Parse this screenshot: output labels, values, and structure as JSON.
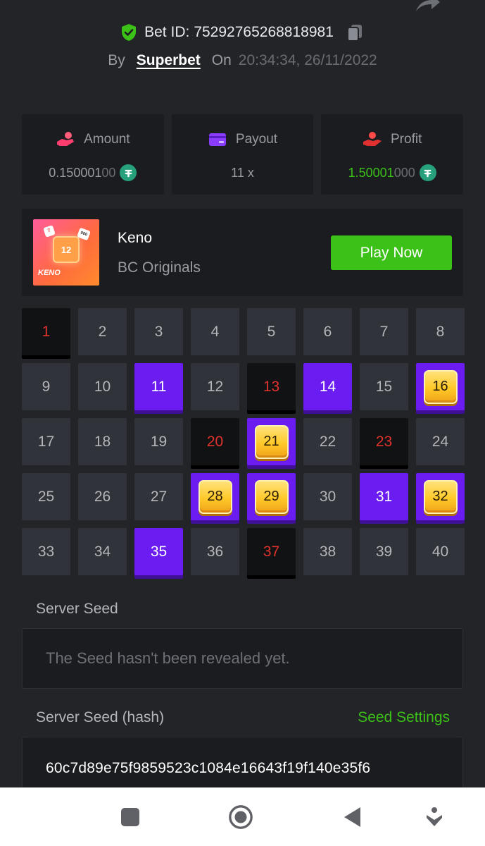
{
  "header": {
    "bet_id_label": "Bet ID:",
    "bet_id": "75292765268818981",
    "by_label": "By",
    "house": "Superbet",
    "on_label": "On",
    "timestamp": "20:34:34, 26/11/2022"
  },
  "stats": {
    "amount": {
      "label": "Amount",
      "value_main": "0.150001",
      "value_dim": "00"
    },
    "payout": {
      "label": "Payout",
      "value": "11 x"
    },
    "profit": {
      "label": "Profit",
      "value_main": "1.50001",
      "value_dim": "000"
    }
  },
  "game": {
    "name": "Keno",
    "provider": "BC Originals",
    "play_label": "Play Now",
    "thumb_number": "12",
    "thumb_label": "KENO"
  },
  "keno": {
    "cells": [
      {
        "n": "1",
        "s": "miss"
      },
      {
        "n": "2",
        "s": "none"
      },
      {
        "n": "3",
        "s": "none"
      },
      {
        "n": "4",
        "s": "none"
      },
      {
        "n": "5",
        "s": "none"
      },
      {
        "n": "6",
        "s": "none"
      },
      {
        "n": "7",
        "s": "none"
      },
      {
        "n": "8",
        "s": "none"
      },
      {
        "n": "9",
        "s": "none"
      },
      {
        "n": "10",
        "s": "none"
      },
      {
        "n": "11",
        "s": "pick"
      },
      {
        "n": "12",
        "s": "none"
      },
      {
        "n": "13",
        "s": "miss"
      },
      {
        "n": "14",
        "s": "pick"
      },
      {
        "n": "15",
        "s": "none"
      },
      {
        "n": "16",
        "s": "hit"
      },
      {
        "n": "17",
        "s": "none"
      },
      {
        "n": "18",
        "s": "none"
      },
      {
        "n": "19",
        "s": "none"
      },
      {
        "n": "20",
        "s": "miss"
      },
      {
        "n": "21",
        "s": "hit"
      },
      {
        "n": "22",
        "s": "none"
      },
      {
        "n": "23",
        "s": "miss"
      },
      {
        "n": "24",
        "s": "none"
      },
      {
        "n": "25",
        "s": "none"
      },
      {
        "n": "26",
        "s": "none"
      },
      {
        "n": "27",
        "s": "none"
      },
      {
        "n": "28",
        "s": "hit"
      },
      {
        "n": "29",
        "s": "hit"
      },
      {
        "n": "30",
        "s": "none"
      },
      {
        "n": "31",
        "s": "pick"
      },
      {
        "n": "32",
        "s": "hit"
      },
      {
        "n": "33",
        "s": "none"
      },
      {
        "n": "34",
        "s": "none"
      },
      {
        "n": "35",
        "s": "pick"
      },
      {
        "n": "36",
        "s": "none"
      },
      {
        "n": "37",
        "s": "miss"
      },
      {
        "n": "38",
        "s": "none"
      },
      {
        "n": "39",
        "s": "none"
      },
      {
        "n": "40",
        "s": "none"
      }
    ]
  },
  "seeds": {
    "server_seed_label": "Server Seed",
    "server_seed_value": "The Seed hasn't been revealed yet.",
    "hash_label": "Server Seed (hash)",
    "settings_label": "Seed Settings",
    "hash_value": "60c7d89e75f9859523c1084e16643f19f140e35f6"
  },
  "colors": {
    "accent_green": "#3bc117",
    "pick_purple": "#6b1cf0",
    "miss_red": "#e2322e",
    "tether_green": "#26a17b"
  },
  "icons": {
    "verified": "shield-check-icon",
    "copy": "copy-icon",
    "amount": "coin-hand-icon",
    "payout": "wallet-card-icon",
    "profit": "profit-hand-icon",
    "currency": "tether-icon",
    "nav": [
      "square-nav-icon",
      "home-circle-nav-icon",
      "back-triangle-nav-icon",
      "download-nav-icon"
    ]
  }
}
